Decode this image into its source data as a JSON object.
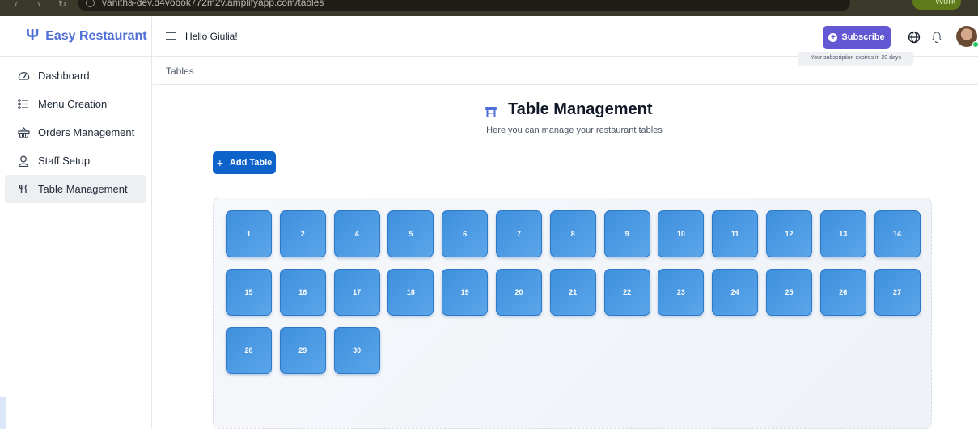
{
  "browser": {
    "url": "vanitha-dev.d4vobok772m2v.amplifyapp.com/tables",
    "profile_label": "Work"
  },
  "sidebar": {
    "brand": "Easy Restaurant",
    "items": [
      {
        "label": "Dashboard",
        "icon": "gauge-icon"
      },
      {
        "label": "Menu Creation",
        "icon": "list-icon"
      },
      {
        "label": "Orders Management",
        "icon": "basket-icon"
      },
      {
        "label": "Staff Setup",
        "icon": "user-icon"
      },
      {
        "label": "Table Management",
        "icon": "utensils-icon",
        "active": true
      }
    ]
  },
  "header": {
    "greeting": "Hello Giulia!",
    "subscribe_label": "Subscribe",
    "subscription_note": "Your subscription expires in 20 days"
  },
  "breadcrumb": "Tables",
  "main": {
    "title": "Table Management",
    "subtitle": "Here you can manage your restaurant tables",
    "add_button_label": "Add Table",
    "tables": [
      "1",
      "2",
      "4",
      "5",
      "6",
      "7",
      "8",
      "9",
      "10",
      "11",
      "12",
      "13",
      "14",
      "15",
      "16",
      "17",
      "18",
      "19",
      "20",
      "21",
      "22",
      "23",
      "24",
      "25",
      "26",
      "27",
      "28",
      "29",
      "30"
    ]
  },
  "colors": {
    "brand": "#4f6fd8",
    "subscribe": "#6357d3",
    "primary_button": "#0d63c9",
    "table_tile": "#4a9ae2"
  }
}
